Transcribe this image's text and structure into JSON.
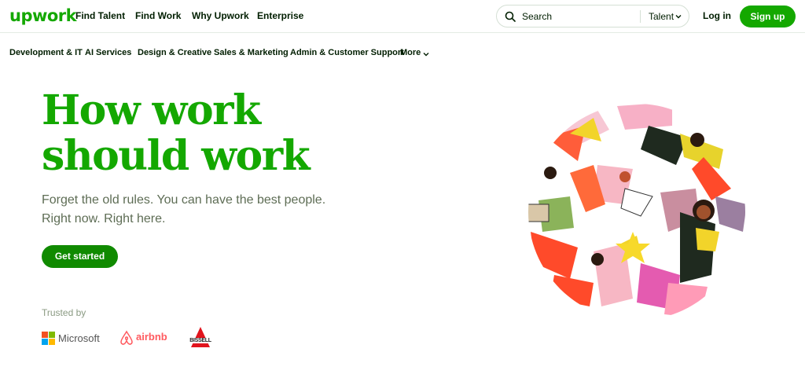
{
  "brand": {
    "logo_text": "upwork",
    "color": "#14a800"
  },
  "nav": {
    "links": [
      "Find Talent",
      "Find Work",
      "Why Upwork",
      "Enterprise"
    ],
    "search": {
      "placeholder": "Search",
      "scope": "Talent"
    },
    "login": "Log in",
    "signup": "Sign up"
  },
  "categories": [
    "Development & IT",
    "AI Services",
    "Design & Creative",
    "Sales & Marketing",
    "Admin & Customer Support",
    "More"
  ],
  "hero": {
    "title_line1": "How work",
    "title_line2": "should work",
    "subtitle_line1": "Forget the old rules. You can have the best people.",
    "subtitle_line2": "Right now. Right here.",
    "cta": "Get started"
  },
  "trusted": {
    "label": "Trusted by",
    "logos": [
      "Microsoft",
      "airbnb",
      "BISSELL"
    ]
  },
  "icons": {
    "search": "search-icon",
    "chevron": "chevron-down-icon"
  }
}
